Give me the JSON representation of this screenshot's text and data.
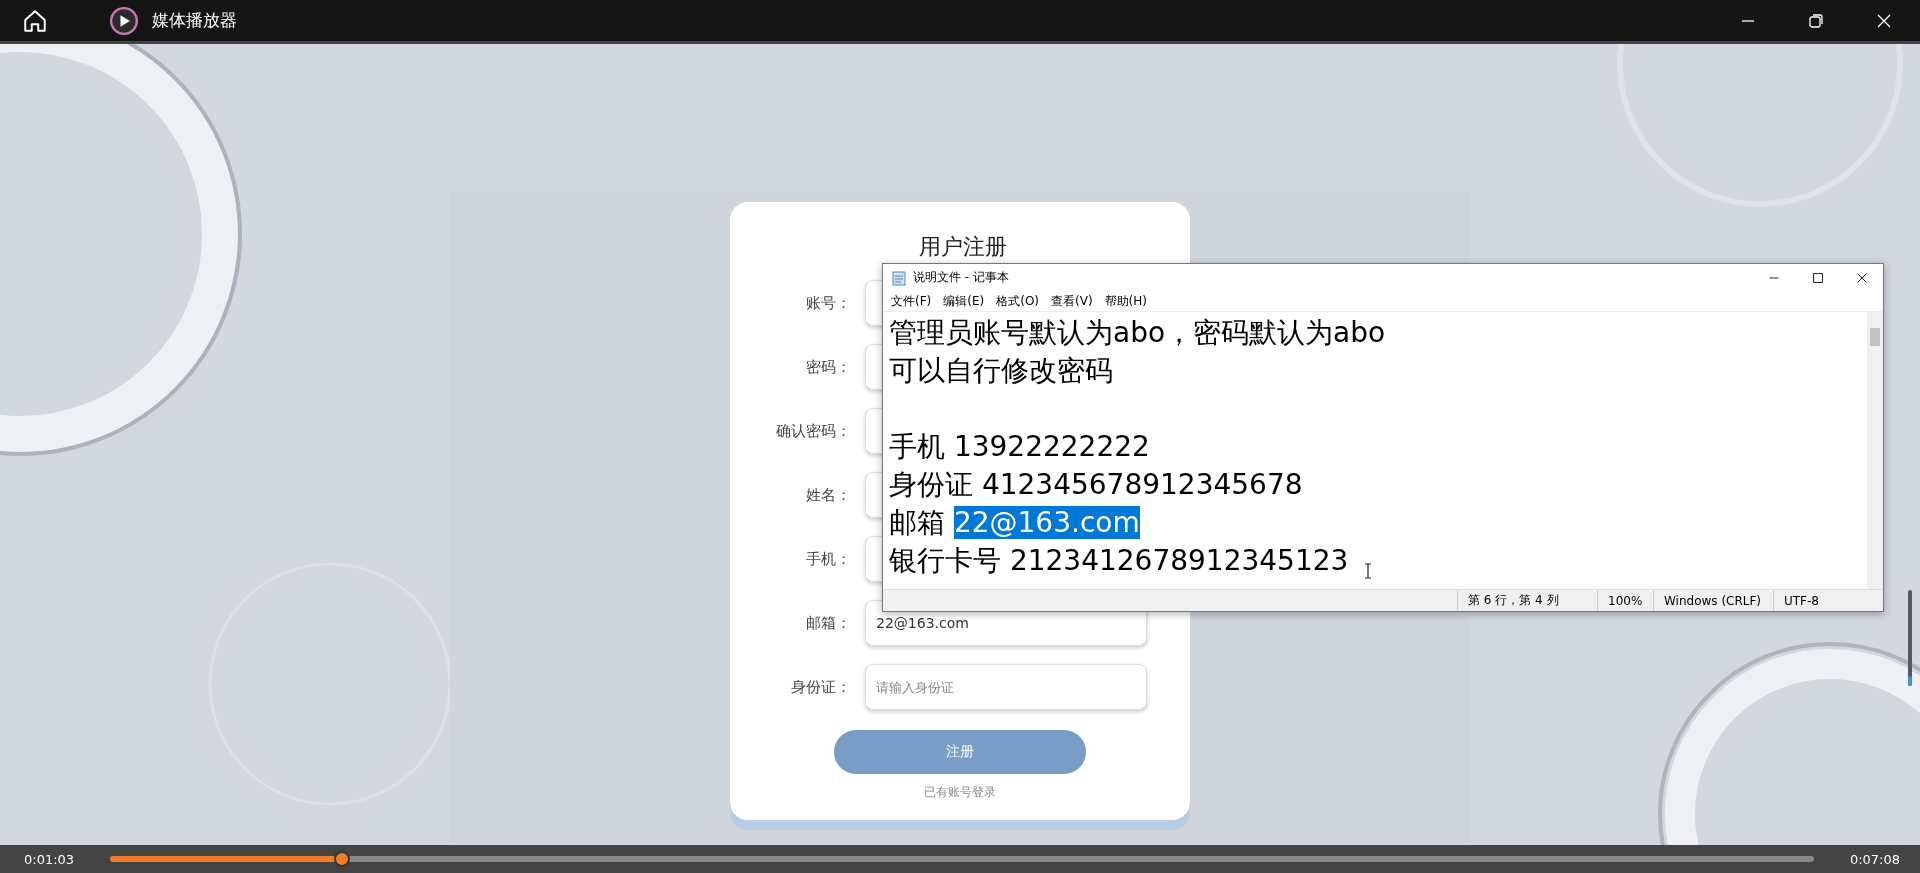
{
  "player": {
    "title": "媒体播放器"
  },
  "form": {
    "title": "用户注册",
    "fields": [
      {
        "label": "账号："
      },
      {
        "label": "密码："
      },
      {
        "label": "确认密码："
      },
      {
        "label": "姓名："
      },
      {
        "label": "手机："
      },
      {
        "label": "邮箱：",
        "value": "22@163.com"
      },
      {
        "label": "身份证：",
        "placeholder": "请输入身份证"
      }
    ],
    "submit": "注册",
    "login_link": "已有账号登录"
  },
  "notepad": {
    "title": "说明文件 - 记事本",
    "menu": [
      "文件(F)",
      "编辑(E)",
      "格式(O)",
      "查看(V)",
      "帮助(H)"
    ],
    "lines": [
      {
        "kind": "text",
        "segments": [
          {
            "text": "管理员账号默认为abo，密码默认为abo",
            "selected": false
          }
        ]
      },
      {
        "kind": "text",
        "segments": [
          {
            "text": "可以自行修改密码",
            "selected": false
          }
        ]
      },
      {
        "kind": "blank"
      },
      {
        "kind": "text",
        "segments": [
          {
            "text": "手机 13922222222",
            "selected": false
          }
        ]
      },
      {
        "kind": "text",
        "segments": [
          {
            "text": "身份证 412345678912345678",
            "selected": false
          }
        ]
      },
      {
        "kind": "text",
        "segments": [
          {
            "text": "邮箱 ",
            "selected": false
          },
          {
            "text": "22@163.com",
            "selected": true
          }
        ]
      },
      {
        "kind": "text",
        "segments": [
          {
            "text": "银行卡号 2123412678912345123",
            "selected": false
          }
        ]
      }
    ],
    "status": [
      "第 6 行，第 4 列",
      "100%",
      "Windows (CRLF)",
      "UTF-8"
    ]
  },
  "playback": {
    "elapsed": "0:01:03",
    "level": 0.136,
    "total": "0:07:08"
  },
  "volume": {
    "level": 0.1
  }
}
